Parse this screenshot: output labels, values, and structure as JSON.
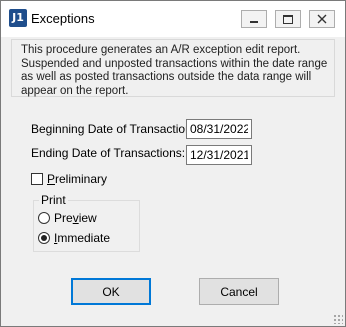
{
  "window": {
    "title": "Exceptions",
    "icon_text": "J1",
    "icon": "app-logo-icon"
  },
  "info": {
    "text": "This procedure generates an A/R exception  edit report. Suspended and unposted transactions within the date range as well as posted transactions outside the data range will appear on the report."
  },
  "fields": {
    "beginning_label": "Beginning Date of Transactions:",
    "beginning_value": "08/31/2022",
    "ending_label": "Ending Date of Transactions:",
    "ending_value": "12/31/2021"
  },
  "preliminary": {
    "label_mnemonic": "P",
    "label_rest": "reliminary",
    "checked": false
  },
  "print": {
    "legend": "Print",
    "preview_prefix": "Pre",
    "preview_mnemonic": "v",
    "preview_suffix": "iew",
    "immediate_mnemonic": "I",
    "immediate_suffix": "mmediate",
    "selected": "Immediate"
  },
  "buttons": {
    "ok": "OK",
    "cancel": "Cancel"
  },
  "colors": {
    "accent": "#0078d7",
    "dialog_bg": "#f0f0f0"
  }
}
